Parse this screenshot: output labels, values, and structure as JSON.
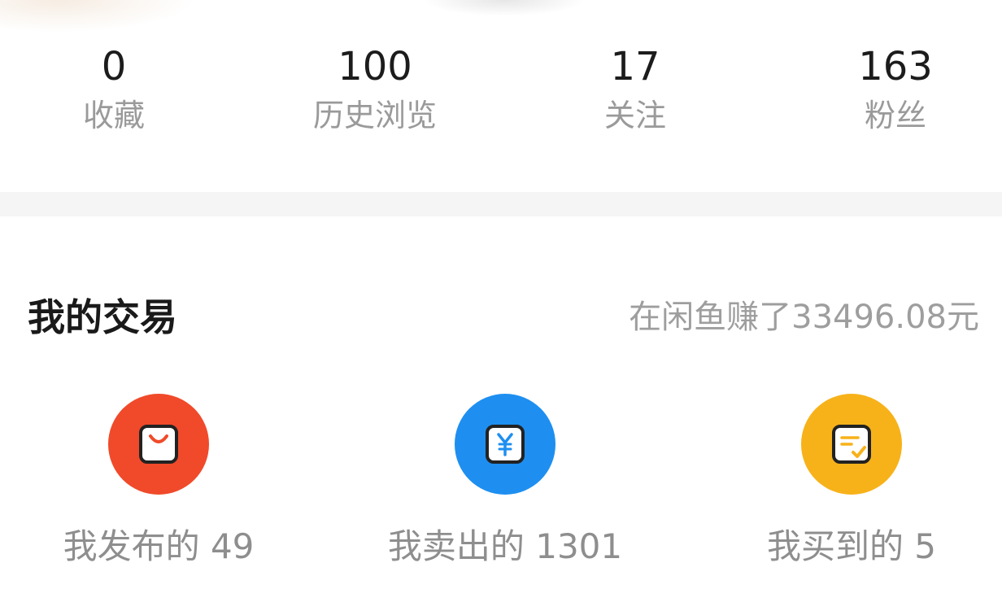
{
  "stats": [
    {
      "value": "0",
      "label": "收藏"
    },
    {
      "value": "100",
      "label": "历史浏览"
    },
    {
      "value": "17",
      "label": "关注"
    },
    {
      "value": "163",
      "label": "粉丝"
    }
  ],
  "trade": {
    "title": "我的交易",
    "earnings": "在闲鱼赚了33496.08元",
    "items": [
      {
        "label": "我发布的 49",
        "icon": "shopping-bag-icon",
        "color": "#f04a2a"
      },
      {
        "label": "我卖出的 1301",
        "icon": "yuan-icon",
        "color": "#1e8ff0"
      },
      {
        "label": "我买到的 5",
        "icon": "receipt-check-icon",
        "color": "#f7b21a"
      }
    ]
  }
}
